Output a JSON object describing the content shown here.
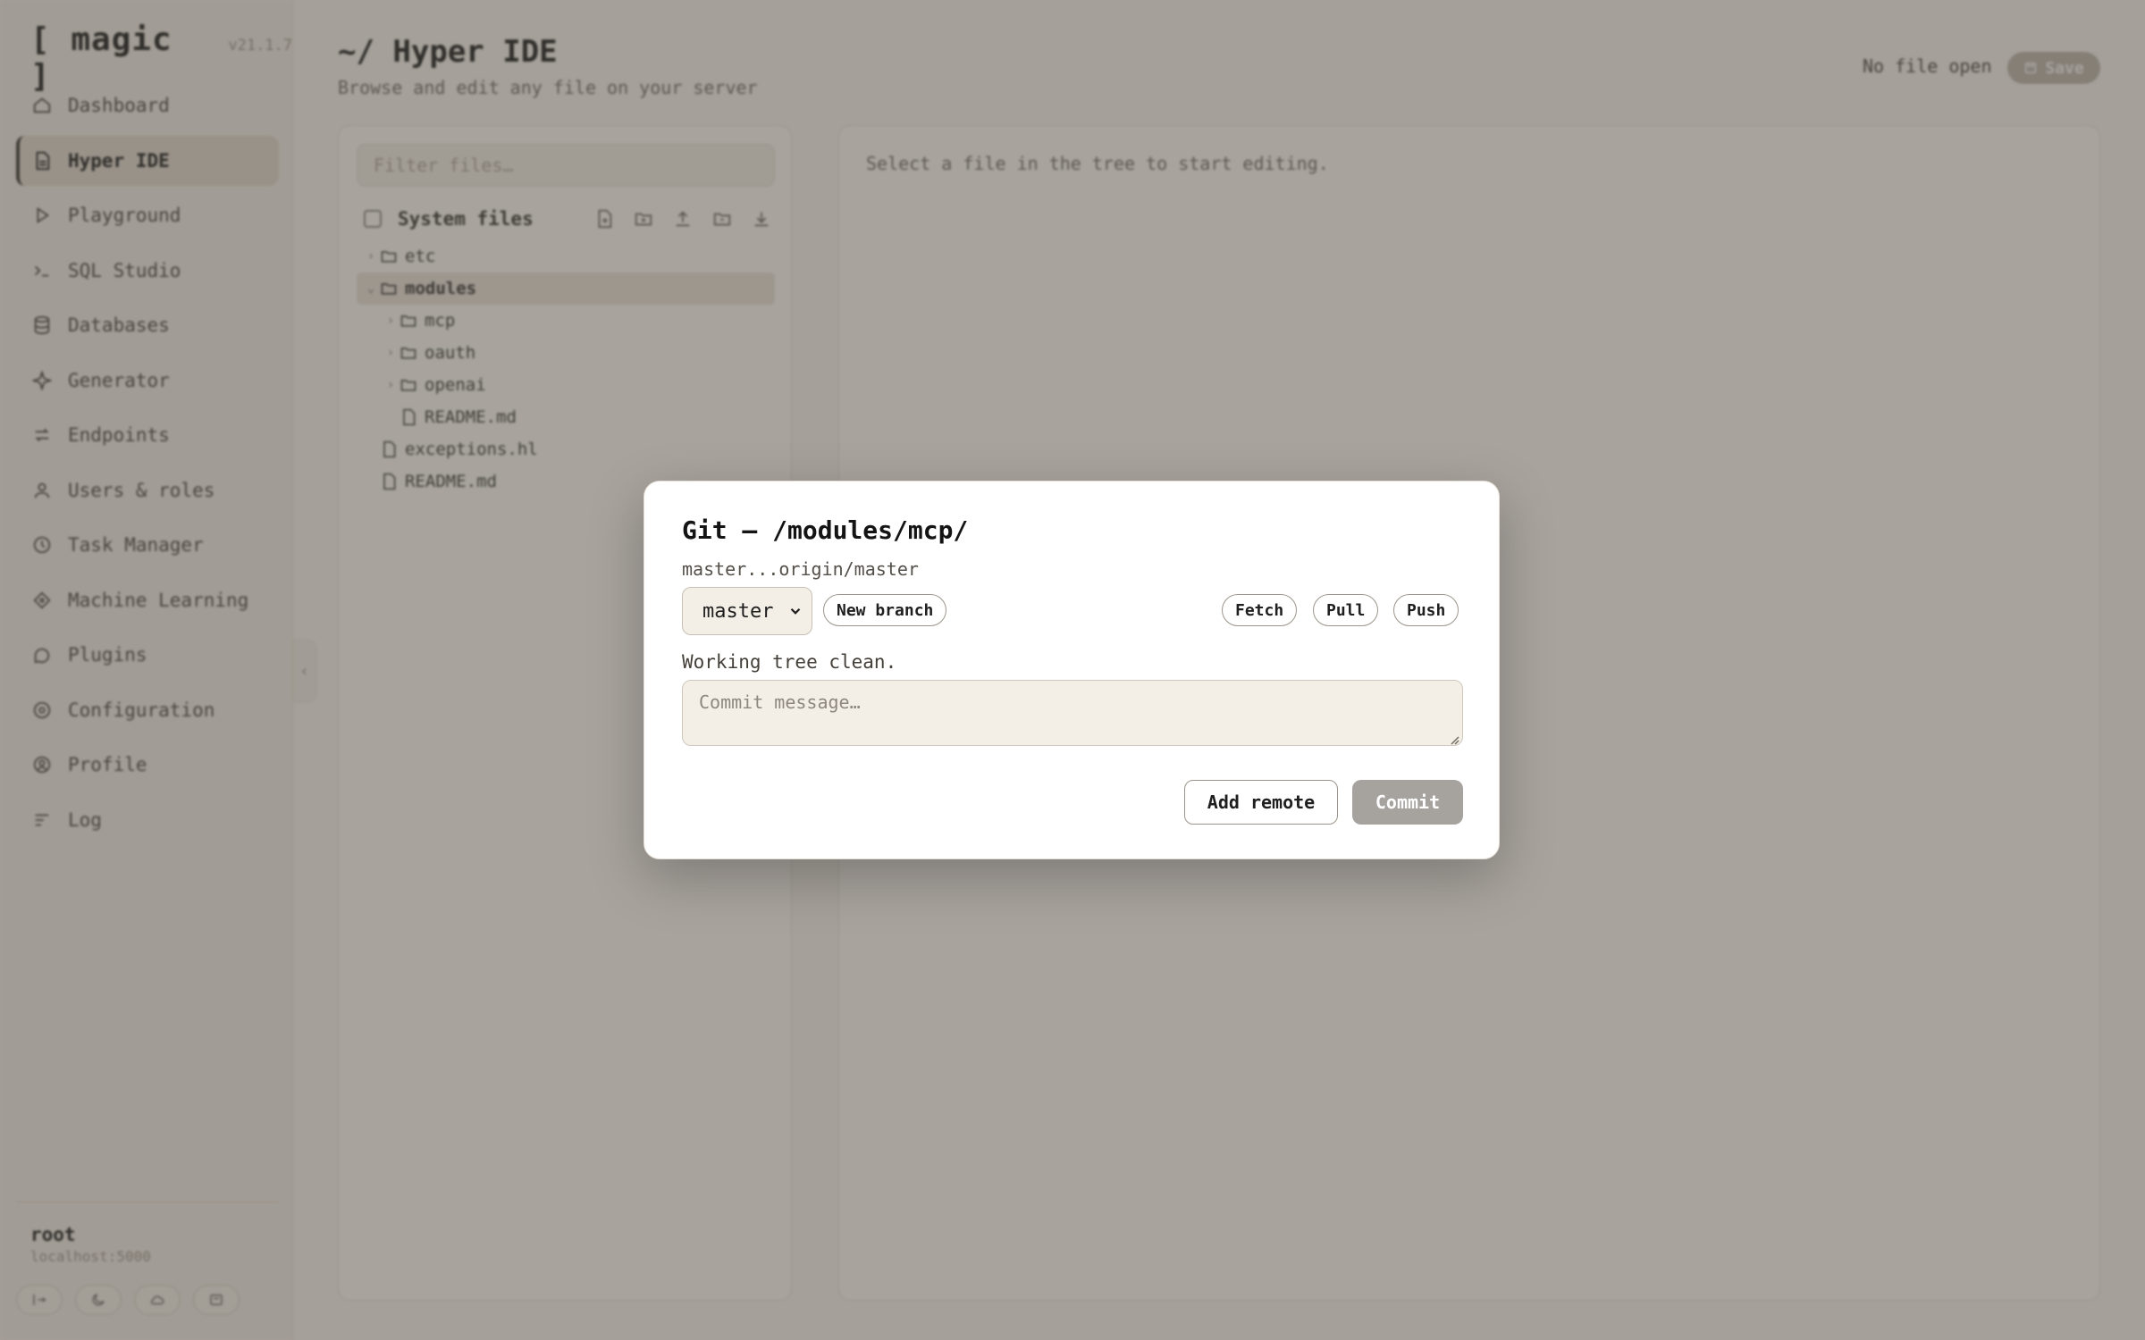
{
  "brand": {
    "name": "[ magic ]",
    "version": "v21.1.7"
  },
  "sidebar": {
    "items": [
      {
        "label": "Dashboard",
        "icon": "home-icon"
      },
      {
        "label": "Hyper IDE",
        "icon": "file-icon",
        "active": true
      },
      {
        "label": "Playground",
        "icon": "play-icon"
      },
      {
        "label": "SQL Studio",
        "icon": "terminal-icon"
      },
      {
        "label": "Databases",
        "icon": "database-icon"
      },
      {
        "label": "Generator",
        "icon": "sparkle-icon"
      },
      {
        "label": "Endpoints",
        "icon": "arrows-icon"
      },
      {
        "label": "Users & roles",
        "icon": "user-icon"
      },
      {
        "label": "Task Manager",
        "icon": "clock-icon"
      },
      {
        "label": "Machine Learning",
        "icon": "ml-icon"
      },
      {
        "label": "Plugins",
        "icon": "plugin-icon"
      },
      {
        "label": "Configuration",
        "icon": "gear-icon"
      },
      {
        "label": "Profile",
        "icon": "profile-icon"
      },
      {
        "label": "Log",
        "icon": "list-icon"
      }
    ],
    "user": {
      "name": "root",
      "host": "localhost:5000"
    }
  },
  "header": {
    "title": "~/ Hyper IDE",
    "subtitle": "Browse and edit any file on your server",
    "file_status": "No file open",
    "save_label": "Save"
  },
  "file_panel": {
    "filter_placeholder": "Filter files…",
    "system_files_label": "System files",
    "tree": [
      {
        "name": "etc",
        "type": "folder",
        "depth": 0,
        "expanded": false
      },
      {
        "name": "modules",
        "type": "folder",
        "depth": 0,
        "expanded": true,
        "selected": true
      },
      {
        "name": "mcp",
        "type": "folder",
        "depth": 1,
        "expanded": false
      },
      {
        "name": "oauth",
        "type": "folder",
        "depth": 1,
        "expanded": false
      },
      {
        "name": "openai",
        "type": "folder",
        "depth": 1,
        "expanded": false
      },
      {
        "name": "README.md",
        "type": "file",
        "depth": 1
      },
      {
        "name": "exceptions.hl",
        "type": "file",
        "depth": 0
      },
      {
        "name": "README.md",
        "type": "file",
        "depth": 0
      }
    ]
  },
  "editor": {
    "hint": "Select a file in the tree to start editing."
  },
  "git_modal": {
    "title": "Git — /modules/mcp/",
    "tracking": "master...origin/master",
    "branch_options": [
      "master"
    ],
    "selected_branch": "master",
    "new_branch_label": "New branch",
    "fetch_label": "Fetch",
    "pull_label": "Pull",
    "push_label": "Push",
    "status": "Working tree clean.",
    "commit_placeholder": "Commit message…",
    "add_remote_label": "Add remote",
    "commit_label": "Commit"
  },
  "colors": {
    "background": "#f2ede6",
    "sidebar": "#ece6de",
    "overlay": "#46423c",
    "modal": "#ffffff",
    "commit_disabled": "#a6a39f"
  }
}
